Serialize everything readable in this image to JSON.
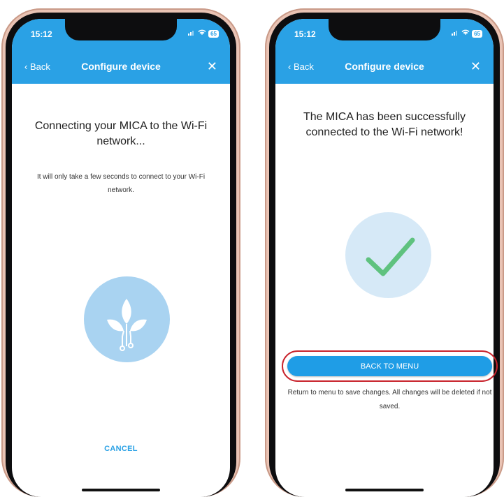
{
  "left_phone": {
    "status": {
      "time": "15:12",
      "battery": "65"
    },
    "nav": {
      "back_label": "‹ Back",
      "title": "Configure device",
      "close_glyph": "✕"
    },
    "heading": "Connecting your MICA to the Wi-Fi network...",
    "subtext": "It will only take a few seconds to connect to your Wi-Fi network.",
    "illustration_icon": "plant-circuit-icon",
    "cancel_label": "CANCEL"
  },
  "right_phone": {
    "status": {
      "time": "15:12",
      "battery": "65"
    },
    "nav": {
      "back_label": "‹ Back",
      "title": "Configure device",
      "close_glyph": "✕"
    },
    "heading": "The MICA has been successfully connected to the Wi-Fi network!",
    "illustration_icon": "checkmark-icon",
    "back_to_menu_label": "BACK TO MENU",
    "note": "Return to menu to save changes. All changes will be deleted if not saved."
  },
  "colors": {
    "primary": "#2aa1e5",
    "button": "#1f9de6",
    "highlight_ring": "#c8232c",
    "illustration_bg_left": "#a9d3f1",
    "illustration_bg_right": "#d6e9f7",
    "check": "#5fc27f",
    "phone_frame": "#e9c3b4"
  }
}
